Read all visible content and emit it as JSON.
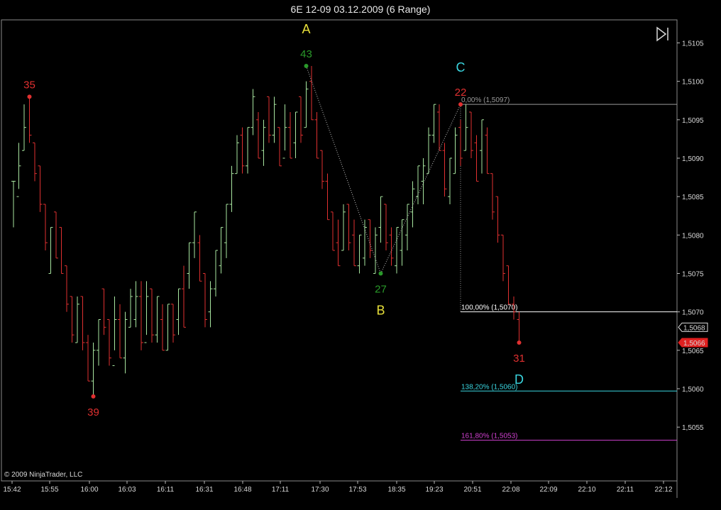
{
  "window": {
    "title": "6E 12-09  03.12.2009 (6 Range)"
  },
  "copyright": "© 2009 NinjaTrader, LLC",
  "colors": {
    "background": "#000000",
    "up_bar": "#a8e6a0",
    "down_bar": "#e03030",
    "swing_high": "#e03030",
    "swing_low_green": "#2a9a2a",
    "pattern_letter_yellow": "#e8e03a",
    "pattern_letter_cyan": "#3ad6e0",
    "fib_0": "#9a9a9a",
    "fib_100": "#ffffff",
    "fib_138": "#3ad6e0",
    "fib_161": "#d040d0",
    "last_price_box": "#e02020"
  },
  "toolbar": {
    "scroll_end_icon": "scroll-to-end-icon"
  },
  "chart_data": {
    "type": "ohlc",
    "instrument": "6E 12-09",
    "date": "03.12.2009",
    "bar_type": "6 Range",
    "ylim": [
      1.5048,
      1.5108
    ],
    "y_ticks": [
      "1,5105",
      "1,5100",
      "1,5095",
      "1,5090",
      "1,5085",
      "1,5080",
      "1,5075",
      "1,5070",
      "1,5065",
      "1,5060",
      "1,5055"
    ],
    "x_ticks": [
      "15:42",
      "15:55",
      "16:00",
      "16:03",
      "16:11",
      "16:31",
      "16:48",
      "17:11",
      "17:30",
      "17:53",
      "18:35",
      "19:23",
      "20:51",
      "22:08",
      "22:09",
      "22:10",
      "22:11",
      "22:12"
    ],
    "bars": [
      {
        "o": 1.5087,
        "c": 1.5087,
        "h": 1.5087,
        "l": 1.5081
      },
      {
        "o": 1.5085,
        "c": 1.5089,
        "h": 1.5092,
        "l": 1.5086
      },
      {
        "o": 1.5091,
        "c": 1.5094,
        "h": 1.5097,
        "l": 1.5091
      },
      {
        "o": 1.5098,
        "c": 1.5093,
        "h": 1.5098,
        "l": 1.5092
      },
      {
        "o": 1.5092,
        "c": 1.5088,
        "h": 1.5092,
        "l": 1.5087
      },
      {
        "o": 1.5089,
        "c": 1.5084,
        "h": 1.5089,
        "l": 1.5083
      },
      {
        "o": 1.5084,
        "c": 1.5079,
        "h": 1.5084,
        "l": 1.5078
      },
      {
        "o": 1.5075,
        "c": 1.5081,
        "h": 1.5081,
        "l": 1.5075
      },
      {
        "o": 1.5083,
        "c": 1.5077,
        "h": 1.5083,
        "l": 1.5077
      },
      {
        "o": 1.5081,
        "c": 1.5075,
        "h": 1.5081,
        "l": 1.5075
      },
      {
        "o": 1.5076,
        "c": 1.5071,
        "h": 1.5076,
        "l": 1.507
      },
      {
        "o": 1.5072,
        "c": 1.5067,
        "h": 1.5072,
        "l": 1.5066
      },
      {
        "o": 1.5066,
        "c": 1.5071,
        "h": 1.5072,
        "l": 1.5066
      },
      {
        "o": 1.5072,
        "c": 1.5066,
        "h": 1.5072,
        "l": 1.5065
      },
      {
        "o": 1.5066,
        "c": 1.5061,
        "h": 1.5067,
        "l": 1.5061
      },
      {
        "o": 1.5061,
        "c": 1.5065,
        "h": 1.5066,
        "l": 1.5059
      },
      {
        "o": 1.5065,
        "c": 1.5069,
        "h": 1.5069,
        "l": 1.5063
      },
      {
        "o": 1.5073,
        "c": 1.5068,
        "h": 1.5073,
        "l": 1.5067
      },
      {
        "o": 1.5069,
        "c": 1.5064,
        "h": 1.5069,
        "l": 1.5063
      },
      {
        "o": 1.5063,
        "c": 1.5069,
        "h": 1.5072,
        "l": 1.5065
      },
      {
        "o": 1.5069,
        "c": 1.5064,
        "h": 1.5071,
        "l": 1.5064
      },
      {
        "o": 1.5064,
        "c": 1.5069,
        "h": 1.507,
        "l": 1.5062
      },
      {
        "o": 1.5068,
        "c": 1.5072,
        "h": 1.5073,
        "l": 1.5068
      },
      {
        "o": 1.5069,
        "c": 1.5072,
        "h": 1.5074,
        "l": 1.5068
      },
      {
        "o": 1.5072,
        "c": 1.5066,
        "h": 1.5074,
        "l": 1.5065
      },
      {
        "o": 1.5066,
        "c": 1.5072,
        "h": 1.5074,
        "l": 1.5067
      },
      {
        "o": 1.5073,
        "c": 1.5067,
        "h": 1.5073,
        "l": 1.5066
      },
      {
        "o": 1.5067,
        "c": 1.5072,
        "h": 1.5072,
        "l": 1.5066
      },
      {
        "o": 1.5069,
        "c": 1.5065,
        "h": 1.5071,
        "l": 1.5065
      },
      {
        "o": 1.5065,
        "c": 1.5071,
        "h": 1.5071,
        "l": 1.5065
      },
      {
        "o": 1.5071,
        "c": 1.5067,
        "h": 1.5071,
        "l": 1.5066
      },
      {
        "o": 1.5069,
        "c": 1.5073,
        "h": 1.5073,
        "l": 1.5067
      },
      {
        "o": 1.5073,
        "c": 1.5068,
        "h": 1.5076,
        "l": 1.5068
      },
      {
        "o": 1.5075,
        "c": 1.5079,
        "h": 1.5079,
        "l": 1.5073
      },
      {
        "o": 1.5079,
        "c": 1.5083,
        "h": 1.5083,
        "l": 1.5077
      },
      {
        "o": 1.5079,
        "c": 1.5074,
        "h": 1.508,
        "l": 1.5074
      },
      {
        "o": 1.5075,
        "c": 1.5069,
        "h": 1.5075,
        "l": 1.5068
      },
      {
        "o": 1.507,
        "c": 1.5073,
        "h": 1.5074,
        "l": 1.5068
      },
      {
        "o": 1.5073,
        "c": 1.5078,
        "h": 1.5078,
        "l": 1.5072
      },
      {
        "o": 1.5076,
        "c": 1.5081,
        "h": 1.5081,
        "l": 1.5075
      },
      {
        "o": 1.5079,
        "c": 1.5084,
        "h": 1.5084,
        "l": 1.5077
      },
      {
        "o": 1.5084,
        "c": 1.5088,
        "h": 1.5089,
        "l": 1.5083
      },
      {
        "o": 1.5088,
        "c": 1.5092,
        "h": 1.5093,
        "l": 1.5088
      },
      {
        "o": 1.5093,
        "c": 1.5089,
        "h": 1.5094,
        "l": 1.5088
      },
      {
        "o": 1.5089,
        "c": 1.5094,
        "h": 1.5094,
        "l": 1.5088
      },
      {
        "o": 1.5094,
        "c": 1.5098,
        "h": 1.5099,
        "l": 1.5093
      },
      {
        "o": 1.5095,
        "c": 1.509,
        "h": 1.5096,
        "l": 1.509
      },
      {
        "o": 1.5091,
        "c": 1.5094,
        "h": 1.5095,
        "l": 1.5089
      },
      {
        "o": 1.5098,
        "c": 1.5093,
        "h": 1.5098,
        "l": 1.5092
      },
      {
        "o": 1.5093,
        "c": 1.5097,
        "h": 1.5098,
        "l": 1.5092
      },
      {
        "o": 1.5094,
        "c": 1.5089,
        "h": 1.5094,
        "l": 1.5089
      },
      {
        "o": 1.509,
        "c": 1.5094,
        "h": 1.5097,
        "l": 1.5091
      },
      {
        "o": 1.5094,
        "c": 1.509,
        "h": 1.5096,
        "l": 1.509
      },
      {
        "o": 1.5092,
        "c": 1.5096,
        "h": 1.5096,
        "l": 1.509
      },
      {
        "o": 1.5098,
        "c": 1.5093,
        "h": 1.5098,
        "l": 1.5092
      },
      {
        "o": 1.5094,
        "c": 1.5099,
        "h": 1.51,
        "l": 1.5094
      },
      {
        "o": 1.51,
        "c": 1.5095,
        "h": 1.5102,
        "l": 1.5095
      },
      {
        "o": 1.5095,
        "c": 1.509,
        "h": 1.5096,
        "l": 1.509
      },
      {
        "o": 1.5091,
        "c": 1.5087,
        "h": 1.5091,
        "l": 1.5086
      },
      {
        "o": 1.5087,
        "c": 1.5082,
        "h": 1.5088,
        "l": 1.5082
      },
      {
        "o": 1.5083,
        "c": 1.5078,
        "h": 1.5083,
        "l": 1.5078
      },
      {
        "o": 1.5079,
        "c": 1.5076,
        "h": 1.5082,
        "l": 1.5076
      },
      {
        "o": 1.5078,
        "c": 1.5083,
        "h": 1.5084,
        "l": 1.5078
      },
      {
        "o": 1.5084,
        "c": 1.5079,
        "h": 1.5084,
        "l": 1.5078
      },
      {
        "o": 1.508,
        "c": 1.5076,
        "h": 1.5082,
        "l": 1.5076
      },
      {
        "o": 1.5076,
        "c": 1.508,
        "h": 1.508,
        "l": 1.5075
      },
      {
        "o": 1.5077,
        "c": 1.5081,
        "h": 1.5082,
        "l": 1.5076
      },
      {
        "o": 1.5082,
        "c": 1.5078,
        "h": 1.5082,
        "l": 1.5077
      },
      {
        "o": 1.5075,
        "c": 1.508,
        "h": 1.5081,
        "l": 1.5075
      },
      {
        "o": 1.5081,
        "c": 1.5085,
        "h": 1.5085,
        "l": 1.5079
      },
      {
        "o": 1.5084,
        "c": 1.5079,
        "h": 1.5084,
        "l": 1.5078
      },
      {
        "o": 1.508,
        "c": 1.5077,
        "h": 1.5081,
        "l": 1.5076
      },
      {
        "o": 1.5076,
        "c": 1.5081,
        "h": 1.5081,
        "l": 1.5075
      },
      {
        "o": 1.5078,
        "c": 1.5082,
        "h": 1.5082,
        "l": 1.5076
      },
      {
        "o": 1.508,
        "c": 1.5084,
        "h": 1.5084,
        "l": 1.5078
      },
      {
        "o": 1.5083,
        "c": 1.5086,
        "h": 1.5087,
        "l": 1.5081
      },
      {
        "o": 1.5085,
        "c": 1.5089,
        "h": 1.5089,
        "l": 1.5084
      },
      {
        "o": 1.5087,
        "c": 1.5089,
        "h": 1.509,
        "l": 1.5084
      },
      {
        "o": 1.5088,
        "c": 1.5093,
        "h": 1.5094,
        "l": 1.5088
      },
      {
        "o": 1.5093,
        "c": 1.5097,
        "h": 1.5097,
        "l": 1.5092
      },
      {
        "o": 1.5096,
        "c": 1.5091,
        "h": 1.5097,
        "l": 1.5091
      },
      {
        "o": 1.5091,
        "c": 1.5086,
        "h": 1.5092,
        "l": 1.5085
      },
      {
        "o": 1.5085,
        "c": 1.509,
        "h": 1.509,
        "l": 1.5084
      },
      {
        "o": 1.5088,
        "c": 1.5093,
        "h": 1.5094,
        "l": 1.5088
      },
      {
        "o": 1.5094,
        "c": 1.509,
        "h": 1.5095,
        "l": 1.5089
      },
      {
        "o": 1.5091,
        "c": 1.5094,
        "h": 1.5097,
        "l": 1.5091
      },
      {
        "o": 1.5096,
        "c": 1.5091,
        "h": 1.5096,
        "l": 1.509
      },
      {
        "o": 1.5092,
        "c": 1.5087,
        "h": 1.5093,
        "l": 1.5087
      },
      {
        "o": 1.5091,
        "c": 1.5095,
        "h": 1.5095,
        "l": 1.5088
      },
      {
        "o": 1.5093,
        "c": 1.5088,
        "h": 1.5094,
        "l": 1.5088
      },
      {
        "o": 1.5088,
        "c": 1.5083,
        "h": 1.5088,
        "l": 1.5082
      },
      {
        "o": 1.5085,
        "c": 1.508,
        "h": 1.5085,
        "l": 1.5079
      },
      {
        "o": 1.508,
        "c": 1.5075,
        "h": 1.508,
        "l": 1.5074
      },
      {
        "o": 1.5076,
        "c": 1.5071,
        "h": 1.5076,
        "l": 1.5071
      },
      {
        "o": 1.5071,
        "c": 1.507,
        "h": 1.5072,
        "l": 1.5069
      },
      {
        "o": 1.5069,
        "c": 1.5066,
        "h": 1.507,
        "l": 1.5066
      }
    ],
    "swing_points": [
      {
        "bar": 3,
        "price": 1.5098,
        "label": "35",
        "color": "#e03030",
        "pos": "above"
      },
      {
        "bar": 15,
        "price": 1.5059,
        "label": "39",
        "color": "#e03030",
        "pos": "below"
      },
      {
        "bar": 55,
        "price": 1.5102,
        "label": "43",
        "color": "#2a9a2a",
        "pos": "above"
      },
      {
        "bar": 69,
        "price": 1.5075,
        "label": "27",
        "color": "#2a9a2a",
        "pos": "below"
      },
      {
        "bar": 84,
        "price": 1.5097,
        "label": "22",
        "color": "#e03030",
        "pos": "above"
      },
      {
        "bar": 95,
        "price": 1.5066,
        "label": "31",
        "color": "#e03030",
        "pos": "below"
      }
    ],
    "pattern_points": [
      {
        "name": "A",
        "bar": 55,
        "price": 1.5102,
        "color": "#e8e03a",
        "pos": "above"
      },
      {
        "name": "B",
        "bar": 69,
        "price": 1.5075,
        "color": "#e8e03a",
        "pos": "below"
      },
      {
        "name": "C",
        "bar": 84,
        "price": 1.5097,
        "color": "#3ad6e0",
        "pos": "above"
      },
      {
        "name": "D",
        "bar": 95,
        "price": 1.5066,
        "color": "#3ad6e0",
        "pos": "below"
      }
    ],
    "fib_levels": [
      {
        "label": "0,00% (1,5097)",
        "price": 1.5097,
        "color": "#9a9a9a"
      },
      {
        "label": "100,00% (1,5070)",
        "price": 1.507,
        "color": "#ffffff"
      },
      {
        "label": "138,20% (1,5060)",
        "price": 1.50597,
        "color": "#3ad6e0"
      },
      {
        "label": "161,80% (1,5053)",
        "price": 1.50533,
        "color": "#d040d0"
      }
    ],
    "fib_start_bar": 84,
    "price_markers": [
      {
        "label": "1,5068",
        "price": 1.5068,
        "style": "outline"
      },
      {
        "label": "1,5066",
        "price": 1.5066,
        "style": "filled"
      }
    ]
  }
}
